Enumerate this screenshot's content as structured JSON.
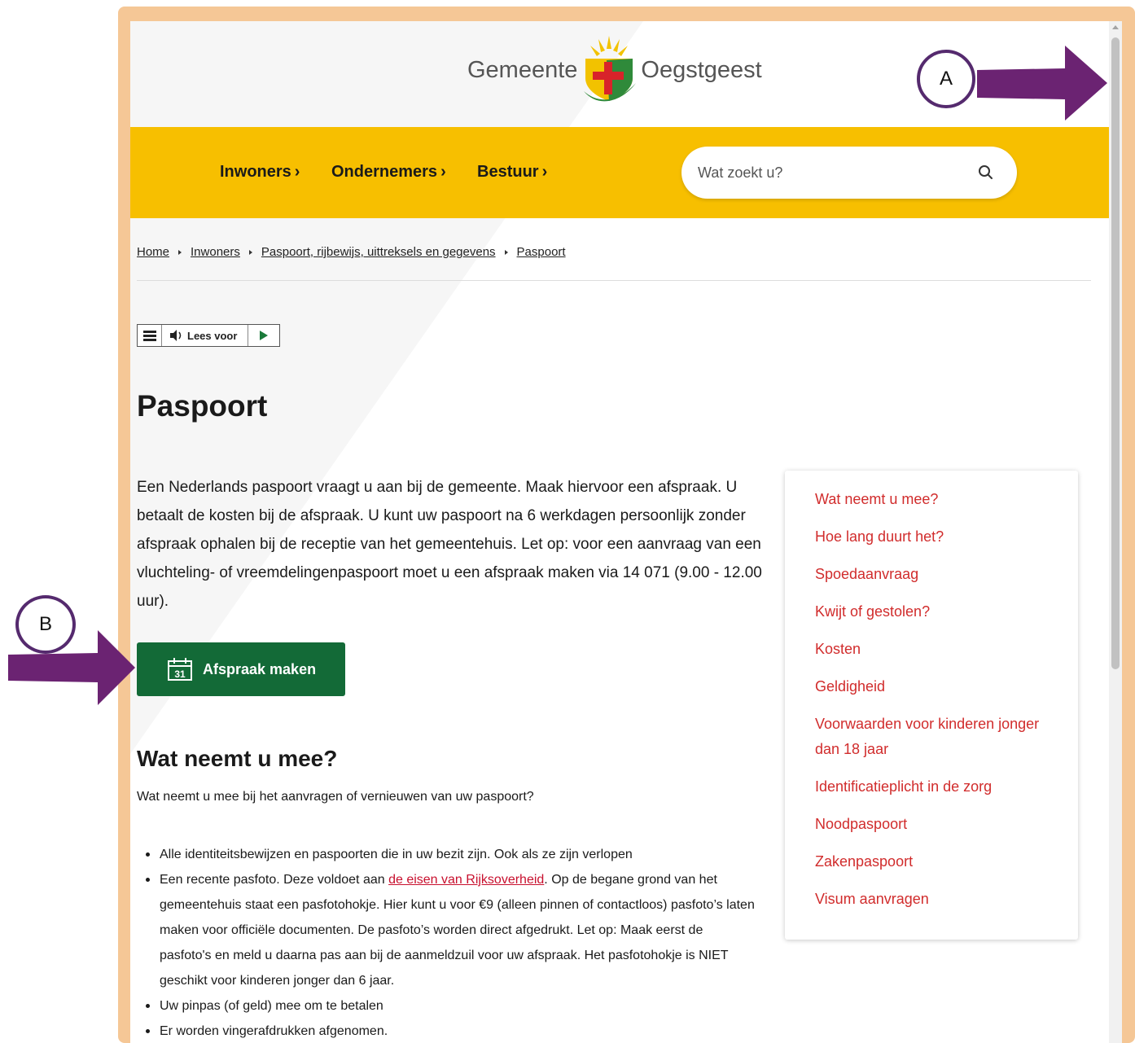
{
  "header": {
    "logo_left": "Gemeente",
    "logo_right": "Oegstgeest"
  },
  "nav": {
    "items": [
      {
        "label": "Inwoners"
      },
      {
        "label": "Ondernemers"
      },
      {
        "label": "Bestuur"
      }
    ],
    "chevron": "›"
  },
  "search": {
    "placeholder": "Wat zoekt u?",
    "icon": "search-icon"
  },
  "breadcrumb": [
    {
      "label": "Home"
    },
    {
      "label": "Inwoners"
    },
    {
      "label": "Paspoort, rijbewijs, uittreksels en gegevens"
    },
    {
      "label": "Paspoort"
    }
  ],
  "readaloud": {
    "label": "Lees voor"
  },
  "main": {
    "title": "Paspoort",
    "intro": "Een Nederlands paspoort vraagt u aan bij de gemeente. Maak hiervoor een afspraak. U betaalt de kosten bij de afspraak. U kunt uw paspoort na 6 werkdagen persoonlijk zonder afspraak ophalen bij de receptie van het gemeentehuis. Let op: voor een aanvraag van een vluchteling- of vreemdelingenpaspoort moet u een afspraak maken via 14 071 (9.00 - 12.00 uur).",
    "appointment_button": "Afspraak maken",
    "calendar_day": "31",
    "section_heading": "Wat neemt u mee?",
    "section_sub": "Wat neemt u mee bij het aanvragen of vernieuwen van uw paspoort?",
    "list": {
      "item1": "Alle identiteitsbewijzen en paspoorten die in uw bezit zijn. Ook als ze zijn verlopen",
      "item2_before": "Een recente pasfoto. Deze voldoet aan ",
      "item2_link": "de eisen van Rijksoverheid",
      "item2_after": ". Op de begane grond van het gemeentehuis staat een pasfotohokje. Hier kunt u voor €9 (alleen pinnen of contactloos) pasfoto’s laten maken voor officiële documenten. De pasfoto’s worden direct afgedrukt. Let op: Maak eerst de pasfoto's en meld u daarna pas aan bij de aanmeldzuil voor uw afspraak. Het pasfotohokje is NIET geschikt voor kinderen jonger dan 6 jaar.",
      "item3": "Uw pinpas (of geld) mee om te betalen",
      "item4": "Er worden vingerafdrukken afgenomen."
    }
  },
  "toc": [
    "Wat neemt u mee?",
    "Hoe lang duurt het?",
    "Spoedaanvraag",
    "Kwijt of gestolen?",
    "Kosten",
    "Geldigheid",
    "Voorwaarden voor kinderen jonger dan 18 jaar",
    "Identificatieplicht in de zorg",
    "Noodpaspoort",
    "Zakenpaspoort",
    "Visum aanvragen"
  ],
  "annotations": {
    "a": "A",
    "b": "B"
  },
  "colors": {
    "nav_bg": "#f7bf00",
    "button_green": "#136a37",
    "link_red": "#d12c2c",
    "annotation_purple": "#6b2372",
    "frame": "#f5c796"
  }
}
